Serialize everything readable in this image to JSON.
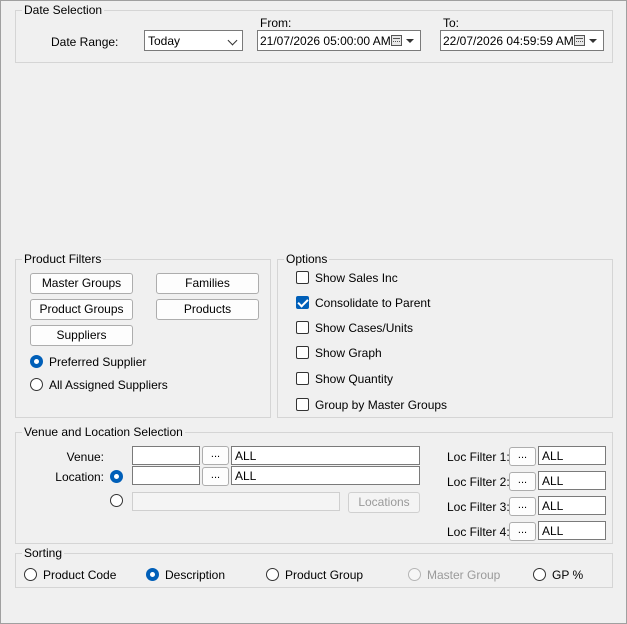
{
  "date_selection": {
    "legend": "Date Selection",
    "date_range_label": "Date Range:",
    "date_range_value": "Today",
    "from_label": "From:",
    "from_value": "21/07/2026 05:00:00 AM",
    "to_label": "To:",
    "to_value": "22/07/2026 04:59:59 AM"
  },
  "product_filters": {
    "legend": "Product Filters",
    "master_groups": "Master Groups",
    "families": "Families",
    "product_groups": "Product Groups",
    "products": "Products",
    "suppliers": "Suppliers",
    "preferred_supplier": "Preferred Supplier",
    "all_assigned_suppliers": "All Assigned Suppliers"
  },
  "options": {
    "legend": "Options",
    "items": [
      {
        "label": "Show Sales Inc",
        "checked": false
      },
      {
        "label": "Consolidate to Parent",
        "checked": true
      },
      {
        "label": "Show Cases/Units",
        "checked": false
      },
      {
        "label": "Show Graph",
        "checked": false
      },
      {
        "label": "Show Quantity",
        "checked": false
      },
      {
        "label": "Group by Master Groups",
        "checked": false
      }
    ]
  },
  "venue": {
    "legend": "Venue and Location Selection",
    "venue_label": "Venue:",
    "venue_button": "...",
    "venue_value": "ALL",
    "location_label": "Location:",
    "location_button": "...",
    "location_value": "ALL",
    "locations_button": "Locations",
    "loc_filters": [
      {
        "label": "Loc Filter 1:",
        "button": "...",
        "value": "ALL"
      },
      {
        "label": "Loc Filter 2:",
        "button": "...",
        "value": "ALL"
      },
      {
        "label": "Loc Filter 3:",
        "button": "...",
        "value": "ALL"
      },
      {
        "label": "Loc Filter 4:",
        "button": "...",
        "value": "ALL"
      }
    ]
  },
  "sorting": {
    "legend": "Sorting",
    "product_code": "Product Code",
    "description": "Description",
    "product_group": "Product Group",
    "master_group": "Master Group",
    "gp_percent": "GP %"
  },
  "colors": {
    "accent": "#005fb8",
    "background": "#f0f0f0",
    "disabled_text": "#9a9a9a"
  }
}
